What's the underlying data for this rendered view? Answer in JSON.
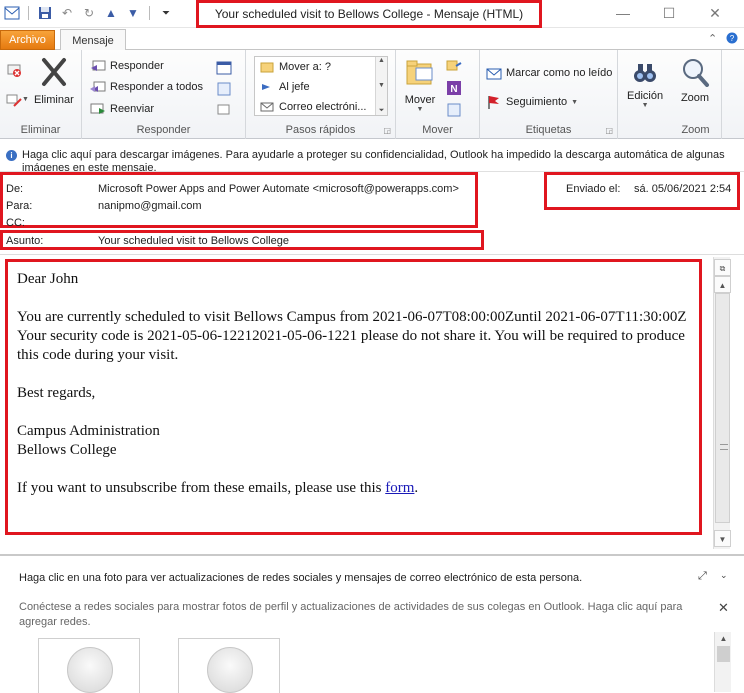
{
  "window": {
    "title": "Your scheduled visit to Bellows College  -  Mensaje (HTML)",
    "controls": {
      "minimize": "—",
      "maximize": "☐",
      "close": "✕"
    }
  },
  "qat": {
    "icons": [
      "save-icon",
      "undo-icon",
      "redo-icon",
      "up-arrow-icon",
      "down-arrow-icon",
      "customize-qat-icon"
    ]
  },
  "tabs": {
    "archivo": "Archivo",
    "mensaje": "Mensaje"
  },
  "ribbon": {
    "eliminar": {
      "label": "Eliminar",
      "delete_button": "Eliminar"
    },
    "responder": {
      "label": "Responder",
      "reply": "Responder",
      "reply_all": "Responder a todos",
      "forward": "Reenviar"
    },
    "pasos_rapidos": {
      "label": "Pasos rápidos",
      "items": [
        "Mover a: ?",
        "Al jefe",
        "Correo electróni..."
      ]
    },
    "mover": {
      "label": "Mover",
      "move_button": "Mover"
    },
    "etiquetas": {
      "label": "Etiquetas",
      "mark_unread": "Marcar como no leído",
      "follow_up": "Seguimiento"
    },
    "edicion": {
      "button": "Edición"
    },
    "zoom": {
      "label": "Zoom",
      "button": "Zoom"
    }
  },
  "infobar": {
    "text": "Haga clic aquí para descargar imágenes. Para ayudarle a proteger su confidencialidad, Outlook ha impedido la descarga automática de algunas imágenes en este mensaje."
  },
  "header": {
    "from_label": "De:",
    "from_value": "Microsoft Power Apps and Power Automate <microsoft@powerapps.com>",
    "to_label": "Para:",
    "to_value": "nanipmo@gmail.com",
    "cc_label": "CC:",
    "subject_label": "Asunto:",
    "subject_value": "Your scheduled visit to Bellows College",
    "sent_label": "Enviado el:",
    "sent_value": "sá. 05/06/2021 2:54"
  },
  "body": {
    "greeting": "Dear John",
    "line1": "You are currently scheduled to visit Bellows Campus from 2021-06-07T08:00:00Zuntil 2021-06-07T11:30:00Z",
    "line2": "Your security code is 2021-05-06-12212021-05-06-1221 please do not share it. You will be required to produce this code during your visit.",
    "regards": "Best regards,",
    "sig1": "Campus Administration",
    "sig2": "Bellows College",
    "unsubscribe": "If you want to unsubscribe from these emails, please use this",
    "unsubscribe_link": "form",
    "unsubscribe_end": "."
  },
  "people_pane": {
    "line1": "Haga clic en una foto para ver actualizaciones de redes sociales y mensajes de correo electrónico de esta persona.",
    "line2": "Conéctese a redes sociales para mostrar fotos de perfil y actualizaciones de actividades de sus colegas en Outlook. Haga clic aquí para agregar redes."
  }
}
